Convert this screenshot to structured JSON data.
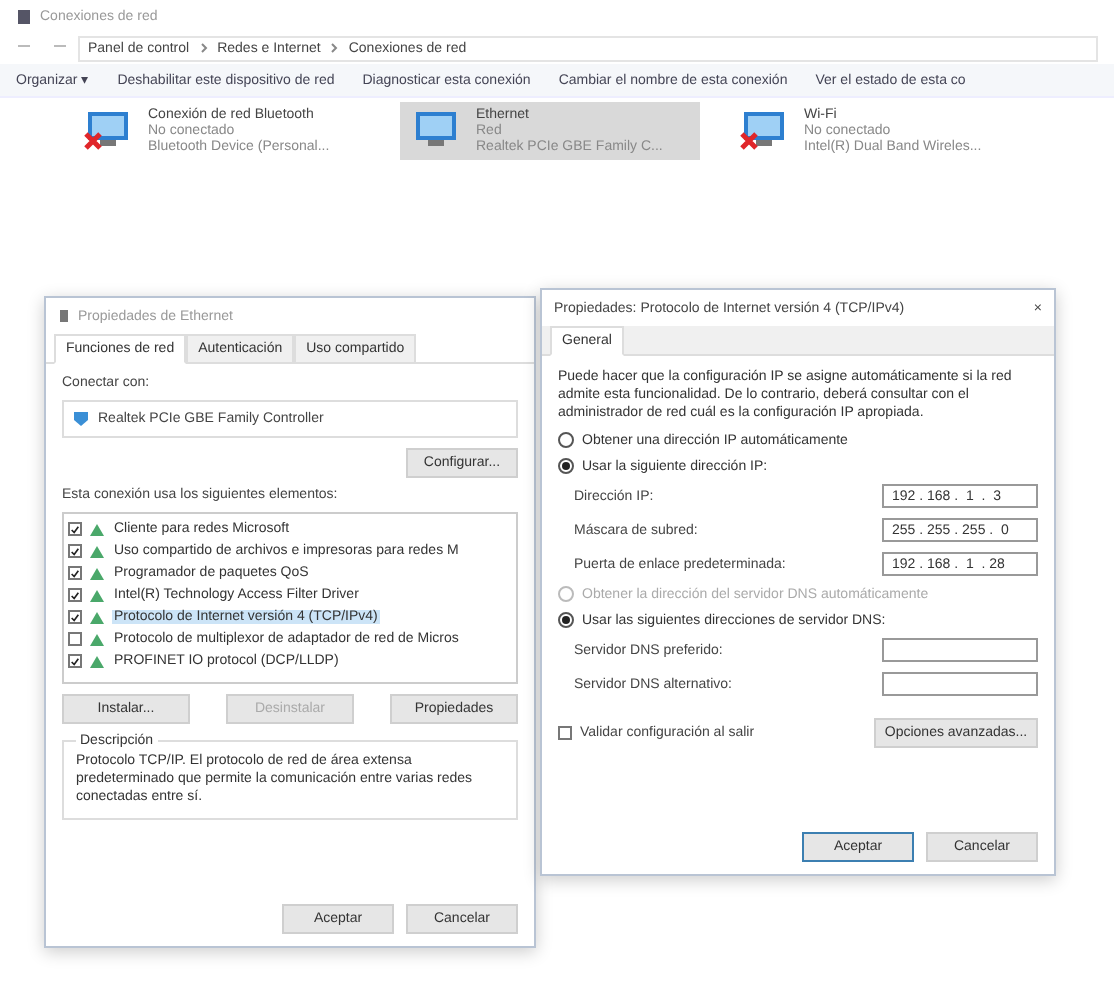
{
  "explorer": {
    "title": "Conexiones de red",
    "breadcrumb": [
      "Panel de control",
      "Redes e Internet",
      "Conexiones de red"
    ],
    "commands": [
      "Organizar ▾",
      "Deshabilitar este dispositivo de red",
      "Diagnosticar esta conexión",
      "Cambiar el nombre de esta conexión",
      "Ver el estado de esta co"
    ],
    "connections": [
      {
        "name": "Conexión de red Bluetooth",
        "status": "No conectado",
        "device": "Bluetooth Device (Personal...",
        "selected": false,
        "connected": false
      },
      {
        "name": "Ethernet",
        "status": "Red",
        "device": "Realtek PCIe GBE Family C...",
        "selected": true,
        "connected": true
      },
      {
        "name": "Wi-Fi",
        "status": "No conectado",
        "device": "Intel(R) Dual Band Wireles...",
        "selected": false,
        "connected": false
      }
    ]
  },
  "ethernet_dialog": {
    "title": "Propiedades de Ethernet",
    "tabs": [
      {
        "label": "Funciones de red",
        "selected": true
      },
      {
        "label": "Autenticación",
        "selected": false
      },
      {
        "label": "Uso compartido",
        "selected": false
      }
    ],
    "connect_label": "Conectar con:",
    "adapter": "Realtek PCIe GBE Family Controller",
    "configure": "Configurar...",
    "items_label": "Esta conexión usa los siguientes elementos:",
    "items": [
      {
        "label": "Cliente para redes Microsoft",
        "checked": true,
        "selected": false
      },
      {
        "label": "Uso compartido de archivos e impresoras para redes M",
        "checked": true,
        "selected": false
      },
      {
        "label": "Programador de paquetes QoS",
        "checked": true,
        "selected": false
      },
      {
        "label": "Intel(R) Technology Access Filter Driver",
        "checked": true,
        "selected": false
      },
      {
        "label": "Protocolo de Internet versión 4 (TCP/IPv4)",
        "checked": true,
        "selected": true
      },
      {
        "label": "Protocolo de multiplexor de adaptador de red de Micros",
        "checked": false,
        "selected": false
      },
      {
        "label": "PROFINET IO protocol (DCP/LLDP)",
        "checked": true,
        "selected": false
      }
    ],
    "actions": [
      {
        "label": "Instalar...",
        "disabled": false
      },
      {
        "label": "Desinstalar",
        "disabled": true
      },
      {
        "label": "Propiedades",
        "disabled": false
      }
    ],
    "description_label": "Descripción",
    "description": "Protocolo TCP/IP. El protocolo de red de área extensa predeterminado que permite la comunicación entre varias redes conectadas entre sí.",
    "buttons": [
      "Aceptar",
      "Cancelar"
    ]
  },
  "ipv4_dialog": {
    "title": "Propiedades: Protocolo de Internet versión 4 (TCP/IPv4)",
    "close": "×",
    "tabs": [
      {
        "label": "General",
        "selected": true
      }
    ],
    "intro": "Puede hacer que la configuración IP se asigne automáticamente si la red admite esta funcionalidad. De lo contrario, deberá consultar con el administrador de red cuál es la configuración IP apropiada.",
    "ip_options": [
      {
        "label": "Obtener una dirección IP automáticamente",
        "selected": false,
        "disabled": false
      },
      {
        "label": "Usar la siguiente dirección IP:",
        "selected": true,
        "disabled": false
      }
    ],
    "ip_fields": [
      {
        "label": "Dirección IP:",
        "value": "192 . 168 .  1  .  3"
      },
      {
        "label": "Máscara de subred:",
        "value": "255 . 255 . 255 .  0"
      },
      {
        "label": "Puerta de enlace predeterminada:",
        "value": "192 . 168 .  1  . 28"
      }
    ],
    "dns_options": [
      {
        "label": "Obtener la dirección del servidor DNS automáticamente",
        "selected": false,
        "disabled": true
      },
      {
        "label": "Usar las siguientes direcciones de servidor DNS:",
        "selected": true,
        "disabled": false
      }
    ],
    "dns_fields": [
      {
        "label": "Servidor DNS preferido:"
      },
      {
        "label": "Servidor DNS alternativo:"
      }
    ],
    "validate": {
      "label": "Validar configuración al salir",
      "checked": false
    },
    "advanced": "Opciones avanzadas...",
    "buttons": [
      "Aceptar",
      "Cancelar"
    ]
  }
}
